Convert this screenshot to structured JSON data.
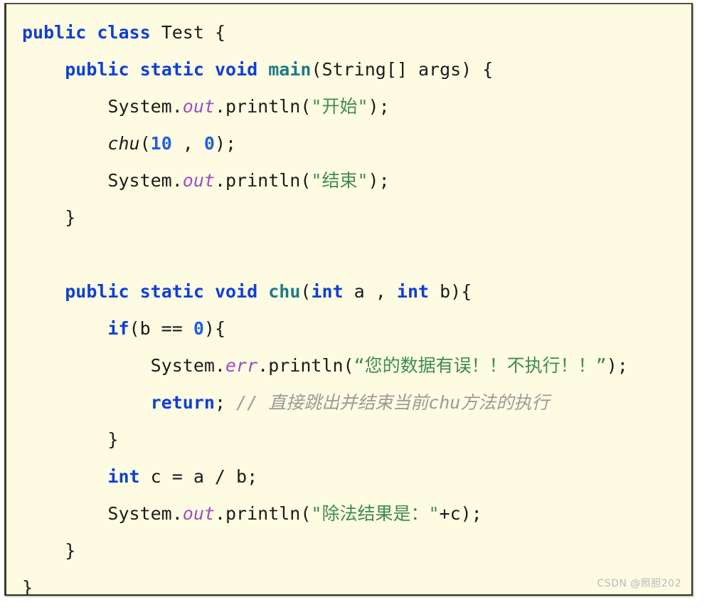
{
  "panel": {
    "background_color": "#fdfbe2",
    "border_color": "#2e2e22",
    "language": "java"
  },
  "theme": {
    "keyword_color": "#0f3fd4",
    "plain_color": "#1b1b1b",
    "method_color": "#1d7b88",
    "field_color": "#9b4fc0",
    "string_color": "#3f8b52",
    "number_color": "#1f5fe0",
    "comment_color": "#9a9a9a"
  },
  "watermark": {
    "text": "CSDN @照胆202"
  },
  "code": {
    "lines": [
      {
        "n": 1,
        "text": "public class Test {",
        "tokens": [
          {
            "t": "public",
            "c": "kw"
          },
          {
            "t": " ",
            "c": "plain"
          },
          {
            "t": "class",
            "c": "kw"
          },
          {
            "t": " Test {",
            "c": "plain"
          }
        ]
      },
      {
        "n": 2,
        "text": "    public static void main(String[] args) {",
        "tokens": [
          {
            "t": "    ",
            "c": "plain"
          },
          {
            "t": "public",
            "c": "kw"
          },
          {
            "t": " ",
            "c": "plain"
          },
          {
            "t": "static",
            "c": "kw"
          },
          {
            "t": " ",
            "c": "plain"
          },
          {
            "t": "void",
            "c": "kw"
          },
          {
            "t": " ",
            "c": "plain"
          },
          {
            "t": "main",
            "c": "method"
          },
          {
            "t": "(String[] args) {",
            "c": "plain"
          }
        ]
      },
      {
        "n": 3,
        "text": "        System.out.println(\"开始\");",
        "tokens": [
          {
            "t": "        System.",
            "c": "plain"
          },
          {
            "t": "out",
            "c": "field"
          },
          {
            "t": ".println(",
            "c": "plain"
          },
          {
            "t": "\"开始\"",
            "c": "str"
          },
          {
            "t": ");",
            "c": "plain"
          }
        ]
      },
      {
        "n": 4,
        "text": "        chu(10 , 0);",
        "tokens": [
          {
            "t": "        ",
            "c": "plain"
          },
          {
            "t": "chu",
            "c": "callita"
          },
          {
            "t": "(",
            "c": "plain"
          },
          {
            "t": "10",
            "c": "num"
          },
          {
            "t": " , ",
            "c": "plain"
          },
          {
            "t": "0",
            "c": "num"
          },
          {
            "t": ");",
            "c": "plain"
          }
        ]
      },
      {
        "n": 5,
        "text": "        System.out.println(\"结束\");",
        "tokens": [
          {
            "t": "        System.",
            "c": "plain"
          },
          {
            "t": "out",
            "c": "field"
          },
          {
            "t": ".println(",
            "c": "plain"
          },
          {
            "t": "\"结束\"",
            "c": "str"
          },
          {
            "t": ");",
            "c": "plain"
          }
        ]
      },
      {
        "n": 6,
        "text": "    }",
        "tokens": [
          {
            "t": "    }",
            "c": "plain"
          }
        ]
      },
      {
        "n": 7,
        "text": "",
        "tokens": []
      },
      {
        "n": 8,
        "text": "    public static void chu(int a , int b){",
        "tokens": [
          {
            "t": "    ",
            "c": "plain"
          },
          {
            "t": "public",
            "c": "kw"
          },
          {
            "t": " ",
            "c": "plain"
          },
          {
            "t": "static",
            "c": "kw"
          },
          {
            "t": " ",
            "c": "plain"
          },
          {
            "t": "void",
            "c": "kw"
          },
          {
            "t": " ",
            "c": "plain"
          },
          {
            "t": "chu",
            "c": "method"
          },
          {
            "t": "(",
            "c": "plain"
          },
          {
            "t": "int",
            "c": "kw"
          },
          {
            "t": " a , ",
            "c": "plain"
          },
          {
            "t": "int",
            "c": "kw"
          },
          {
            "t": " b){",
            "c": "plain"
          }
        ]
      },
      {
        "n": 9,
        "text": "        if(b == 0){",
        "tokens": [
          {
            "t": "        ",
            "c": "plain"
          },
          {
            "t": "if",
            "c": "kw"
          },
          {
            "t": "(b == ",
            "c": "plain"
          },
          {
            "t": "0",
            "c": "num"
          },
          {
            "t": "){",
            "c": "plain"
          }
        ]
      },
      {
        "n": 10,
        "text": "            System.err.println(“您的数据有误！！不执行！！”);",
        "tokens": [
          {
            "t": "            System.",
            "c": "plain"
          },
          {
            "t": "err",
            "c": "field"
          },
          {
            "t": ".println(",
            "c": "plain"
          },
          {
            "t": "“您的数据有误！！不执行！！”",
            "c": "str"
          },
          {
            "t": ");",
            "c": "plain"
          }
        ]
      },
      {
        "n": 11,
        "text": "            return; // 直接跳出并结束当前chu方法的执行",
        "tokens": [
          {
            "t": "            ",
            "c": "plain"
          },
          {
            "t": "return",
            "c": "kw"
          },
          {
            "t": ";",
            "c": "plain"
          },
          {
            "t": " // 直接跳出并结束当前chu方法的执行",
            "c": "comment"
          }
        ]
      },
      {
        "n": 12,
        "text": "        }",
        "tokens": [
          {
            "t": "        }",
            "c": "plain"
          }
        ]
      },
      {
        "n": 13,
        "text": "        int c = a / b;",
        "tokens": [
          {
            "t": "        ",
            "c": "plain"
          },
          {
            "t": "int",
            "c": "kw"
          },
          {
            "t": " c = a / b;",
            "c": "plain"
          }
        ]
      },
      {
        "n": 14,
        "text": "        System.out.println(\"除法结果是：\"+c);",
        "tokens": [
          {
            "t": "        System.",
            "c": "plain"
          },
          {
            "t": "out",
            "c": "field"
          },
          {
            "t": ".println(",
            "c": "plain"
          },
          {
            "t": "\"除法结果是：\"",
            "c": "str"
          },
          {
            "t": "+c);",
            "c": "plain"
          }
        ]
      },
      {
        "n": 15,
        "text": "    }",
        "tokens": [
          {
            "t": "    }",
            "c": "plain"
          }
        ]
      },
      {
        "n": 16,
        "text": "}",
        "tokens": [
          {
            "t": "}",
            "c": "plain"
          }
        ]
      }
    ]
  }
}
